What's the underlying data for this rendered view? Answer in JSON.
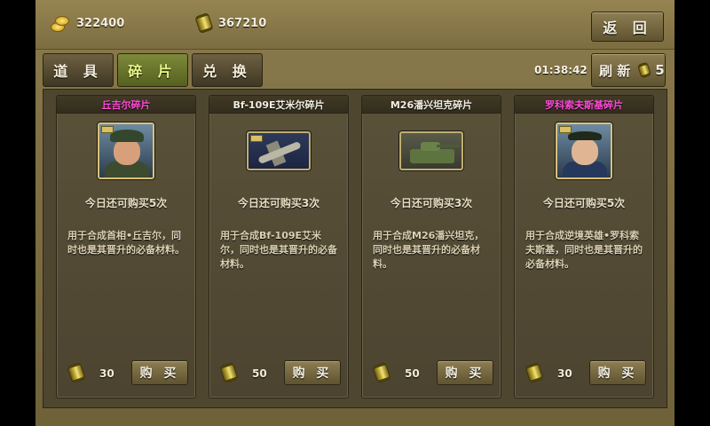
{
  "header": {
    "gold": "322400",
    "oil": "367210",
    "back_label": "返 回"
  },
  "tabs": [
    {
      "label": "道 具",
      "active": false
    },
    {
      "label": "碎 片",
      "active": true
    },
    {
      "label": "兑 换",
      "active": false
    }
  ],
  "timer": "01:38:42",
  "refresh": {
    "label": "刷 新",
    "cost": "5"
  },
  "cards": [
    {
      "title": "丘吉尔碎片",
      "title_color": "#ff4bd8",
      "icon": "churchill-portrait-icon",
      "limit": "今日还可购买5次",
      "desc": "用于合成首相•丘吉尔，同时也是其晋升的必备材料。",
      "price": "30",
      "buy_label": "购 买"
    },
    {
      "title": "Bf-109E艾米尔碎片",
      "title_color": "#f3efe2",
      "icon": "bf109e-plane-icon",
      "limit": "今日还可购买3次",
      "desc": "用于合成Bf-109E艾米尔，同时也是其晋升的必备材料。",
      "price": "50",
      "buy_label": "购 买"
    },
    {
      "title": "M26潘兴坦克碎片",
      "title_color": "#f3efe2",
      "icon": "m26-tank-icon",
      "limit": "今日还可购买3次",
      "desc": "用于合成M26潘兴坦克，同时也是其晋升的必备材料。",
      "price": "50",
      "buy_label": "购 买"
    },
    {
      "title": "罗科索夫斯基碎片",
      "title_color": "#ff4bd8",
      "icon": "rokossovsky-portrait-icon",
      "limit": "今日还可购买5次",
      "desc": "用于合成逆境英雄•罗科索夫斯基，同时也是其晋升的必备材料。",
      "price": "30",
      "buy_label": "购 买"
    }
  ]
}
